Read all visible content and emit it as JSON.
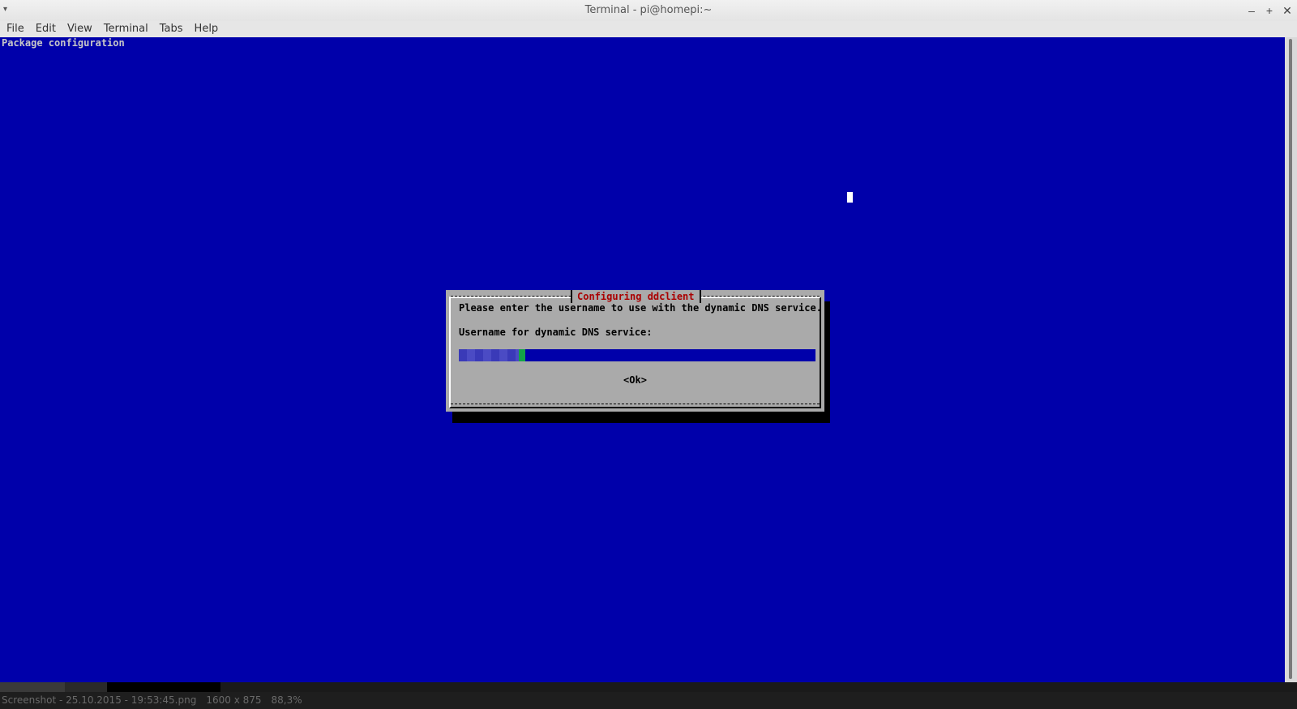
{
  "window": {
    "title": "Terminal - pi@homepi:~",
    "menu_glyph": "▾",
    "controls": {
      "minimize": "–",
      "maximize": "+",
      "close": "✕"
    }
  },
  "menubar": {
    "items": [
      "File",
      "Edit",
      "View",
      "Terminal",
      "Tabs",
      "Help"
    ]
  },
  "terminal": {
    "header": "Package configuration",
    "background_color": "#0000aa"
  },
  "dialog": {
    "title": "Configuring ddclient",
    "description": "Please enter the username to use with the dynamic DNS service.",
    "field_label": "Username for dynamic DNS service:",
    "ok_label": "<Ok>",
    "title_color": "#aa0000"
  },
  "statusbar": {
    "filename": "Screenshot - 25.10.2015 - 19:53:45.png",
    "dimensions": "1600 x 875",
    "zoom": "88,3%"
  }
}
